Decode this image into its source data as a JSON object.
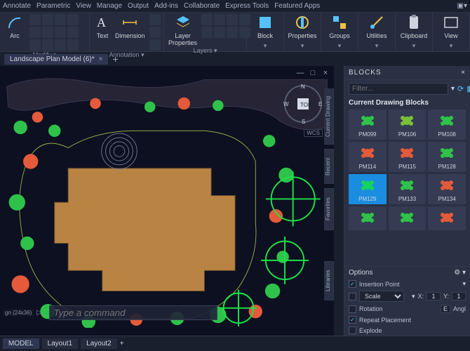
{
  "ribbon_tabs": [
    "Annotate",
    "Parametric",
    "View",
    "Manage",
    "Output",
    "Add-ins",
    "Collaborate",
    "Express Tools",
    "Featured Apps"
  ],
  "ribbon": {
    "draw": {
      "arc_label": "Arc",
      "panel_label": "Modify ▾"
    },
    "anno": {
      "text_label": "Text",
      "dim_label": "Dimension",
      "panel_label": "Annotation ▾"
    },
    "layers": {
      "lp_label": "Layer Properties",
      "panel_label": "Layers ▾"
    },
    "right": {
      "block": "Block",
      "props": "Properties",
      "groups": "Groups",
      "utils": "Utilities",
      "clip": "Clipboard",
      "view": "View"
    }
  },
  "doc_tab": "Landscape Plan Model (6)*",
  "canvas": {
    "wcs": "WCS",
    "top": "TOP",
    "compass": [
      "N",
      "E",
      "S",
      "W"
    ]
  },
  "blocks_panel": {
    "title": "BLOCKS",
    "filter_placeholder": "Filter...",
    "subtitle": "Current Drawing Blocks",
    "vtabs": [
      "Current Drawing",
      "Recent",
      "Favorites",
      "Libraries"
    ],
    "items": [
      {
        "name": "PM099",
        "color": "#2fc24a"
      },
      {
        "name": "PM106",
        "color": "#7bbf3a"
      },
      {
        "name": "PM108",
        "color": "#2fc24a"
      },
      {
        "name": "PM114",
        "color": "#e45a3a"
      },
      {
        "name": "PM115",
        "color": "#e45a3a"
      },
      {
        "name": "PM128",
        "color": "#2fc24a"
      },
      {
        "name": "PM129",
        "color": "#16d35a",
        "selected": true
      },
      {
        "name": "PM133",
        "color": "#2fc24a"
      },
      {
        "name": "PM134",
        "color": "#e45a3a"
      },
      {
        "name": "",
        "color": "#2fc24a"
      },
      {
        "name": "",
        "color": "#2fc24a"
      },
      {
        "name": "",
        "color": "#e45a3a"
      }
    ]
  },
  "options": {
    "title": "Options",
    "insertion": {
      "label": "Insertion Point",
      "checked": true
    },
    "scale": {
      "label": "Scale",
      "checked": false,
      "x_lab": "X:",
      "x": "1",
      "y_lab": "Y:",
      "y": "1"
    },
    "rotation": {
      "label": "Rotation",
      "checked": false,
      "e": "E",
      "ang": "Angl"
    },
    "repeat": {
      "label": "Repeat Placement",
      "checked": true
    },
    "explode": {
      "label": "Explode",
      "checked": false
    }
  },
  "cmd": {
    "coord": "gn (24x36)",
    "placeholder": "Type a command"
  },
  "status_tabs": [
    "MODEL",
    "Layout1",
    "Layout2"
  ]
}
